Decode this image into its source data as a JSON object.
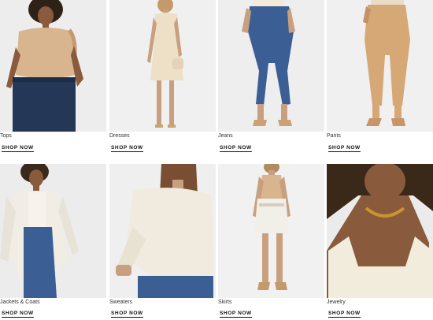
{
  "categories": [
    {
      "label": "Tops",
      "cta": "SHOP NOW",
      "image": "model-in-tan-ruffle-sleeveless-top",
      "color": "#d8b48f"
    },
    {
      "label": "Dresses",
      "cta": "SHOP NOW",
      "image": "model-in-cream-knit-dress",
      "color": "#ede0c6"
    },
    {
      "label": "Jeans",
      "cta": "SHOP NOW",
      "image": "model-in-blue-skinny-jeans",
      "color": "#3b5f95"
    },
    {
      "label": "Pants",
      "cta": "SHOP NOW",
      "image": "model-in-camel-knit-pants",
      "color": "#d6a876"
    },
    {
      "label": "Jackets & Coats",
      "cta": "SHOP NOW",
      "image": "model-in-white-blazer",
      "color": "#f1ede4"
    },
    {
      "label": "Sweaters",
      "cta": "SHOP NOW",
      "image": "model-in-ivory-ribbed-sweater",
      "color": "#f0ebde"
    },
    {
      "label": "Skirts",
      "cta": "SHOP NOW",
      "image": "model-in-white-mini-skirt",
      "color": "#f2efe8"
    },
    {
      "label": "Jewelry",
      "cta": "SHOP NOW",
      "image": "model-wearing-gold-chain-necklace",
      "color": "#c8962e"
    }
  ]
}
